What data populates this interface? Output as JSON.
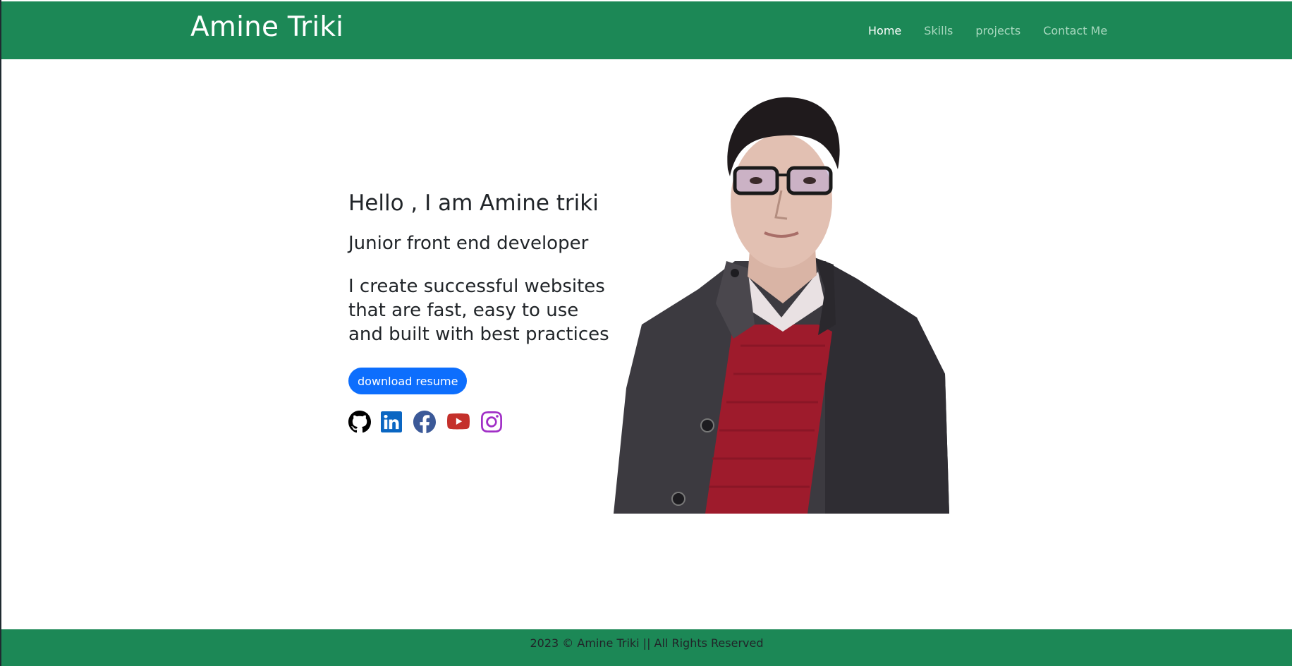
{
  "navbar": {
    "brand": "Amine Triki",
    "links": [
      {
        "label": "Home",
        "active": true
      },
      {
        "label": "Skills",
        "active": false
      },
      {
        "label": "projects",
        "active": false
      },
      {
        "label": "Contact Me",
        "active": false
      }
    ]
  },
  "hero": {
    "greeting": "Hello , I am Amine triki",
    "role": "Junior front end developer",
    "tagline_lines": [
      "I create successful websites",
      "that are fast, easy to use",
      "and built with best practices"
    ],
    "resume_button": "download resume",
    "socials": [
      {
        "icon": "github-icon",
        "color": "#000000"
      },
      {
        "icon": "linkedin-icon",
        "color": "#0a66c2"
      },
      {
        "icon": "facebook-icon",
        "color": "#3b5998"
      },
      {
        "icon": "youtube-icon",
        "color": "#c4302b"
      },
      {
        "icon": "instagram-icon",
        "color": "#a02ec6"
      }
    ]
  },
  "footer": {
    "text": "2023 © Amine Triki || All Rights Reserved"
  },
  "colors": {
    "brand_green": "#1c8856",
    "button_blue": "#0d6efd",
    "text_dark": "#212529"
  }
}
